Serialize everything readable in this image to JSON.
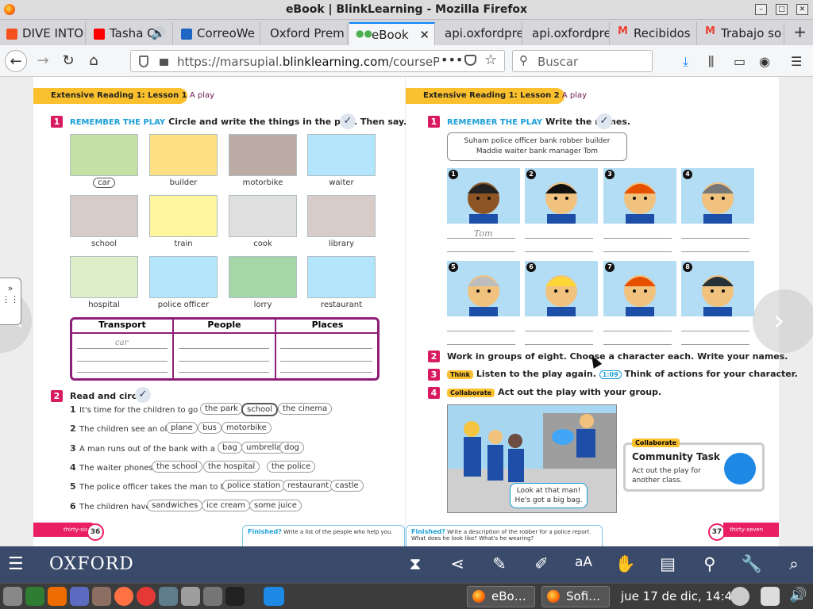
{
  "window": {
    "title": "eBook | BlinkLearning - Mozilla Firefox"
  },
  "tabs": [
    {
      "label": "DIVE INTO",
      "color": "#f4511e"
    },
    {
      "label": "Tasha C",
      "color": "#ff0000"
    },
    {
      "label": "CorreoWe",
      "color": "#1e66c4"
    },
    {
      "label": "Oxford Prem",
      "color": "#ffffff"
    },
    {
      "label": "eBook",
      "color": "#4caf50",
      "active": true
    },
    {
      "label": "api.oxfordpre",
      "color": "#ffffff"
    },
    {
      "label": "api.oxfordpre",
      "color": "#ffffff"
    },
    {
      "label": "Recibidos",
      "color": "#ea4335"
    },
    {
      "label": "Trabajo so",
      "color": "#ea4335"
    }
  ],
  "nav": {
    "url_prefix": "https://marsupial.",
    "url_domain": "blinklearning.com",
    "url_suffix": "/coursePlay",
    "search_placeholder": "Buscar"
  },
  "left": {
    "lesson_bold": "Extensive Reading 1: Lesson 1",
    "lesson_play": "A play",
    "ex1_num": "1",
    "ex1_tag": "REMEMBER THE PLAY",
    "ex1_text": "Circle and write the things in the play. Then say.",
    "pictures": [
      {
        "label": "car",
        "boxed": true,
        "color": "#c5e1a5"
      },
      {
        "label": "builder",
        "color": "#ffe082"
      },
      {
        "label": "motorbike",
        "color": "#bcaaa4"
      },
      {
        "label": "waiter",
        "color": "#b3e5fc"
      },
      {
        "label": "school",
        "color": "#d7ccc8"
      },
      {
        "label": "train",
        "color": "#fff59d"
      },
      {
        "label": "cook",
        "color": "#e0e0e0"
      },
      {
        "label": "library",
        "color": "#d7ccc8"
      },
      {
        "label": "hospital",
        "color": "#dcedc8"
      },
      {
        "label": "police officer",
        "color": "#b3e5fc"
      },
      {
        "label": "lorry",
        "color": "#a5d6a7"
      },
      {
        "label": "restaurant",
        "color": "#b3e5fc"
      }
    ],
    "table_headers": [
      "Transport",
      "People",
      "Places"
    ],
    "table_answer": "car",
    "ex2_num": "2",
    "ex2_text": "Read and circle.",
    "questions": [
      {
        "n": "1",
        "text": "It's time for the children to go to",
        "options": [
          "the park",
          "school",
          "the cinema"
        ],
        "selected": 1
      },
      {
        "n": "2",
        "text": "The children see an old",
        "options": [
          "plane",
          "bus",
          "motorbike"
        ],
        "selected": -1
      },
      {
        "n": "3",
        "text": "A man runs out of the bank with a big",
        "options": [
          "bag",
          "umbrella",
          "dog"
        ],
        "selected": -1
      },
      {
        "n": "4",
        "text": "The waiter phones",
        "options": [
          "the school",
          "the hospital",
          "the police"
        ],
        "selected": -1
      },
      {
        "n": "5",
        "text": "The police officer takes the man to the",
        "options": [
          "police station",
          "restaurant",
          "castle"
        ],
        "selected": -1
      },
      {
        "n": "6",
        "text": "The children have",
        "options": [
          "sandwiches",
          "ice cream",
          "some juice"
        ],
        "selected": -1
      }
    ],
    "page_word": "thirty-six",
    "page_no": "36",
    "finished_label": "Finished?",
    "finished_text": "Write a list of the people who help you."
  },
  "right": {
    "lesson_bold": "Extensive Reading 1: Lesson 2",
    "lesson_play": "A play",
    "ex1_num": "1",
    "ex1_tag": "REMEMBER THE PLAY",
    "ex1_text": "Write the names.",
    "names_line1": "Suham    police officer    bank robber    builder",
    "names_line2": "Maddie    waiter    bank manager    Tom",
    "faces": [
      "1",
      "2",
      "3",
      "4",
      "5",
      "6",
      "7",
      "8"
    ],
    "answer_1": "Tom",
    "ex2_num": "2",
    "ex2_text": "Work in groups of eight. Choose a character each. Write your names.",
    "ex3_num": "3",
    "ex3_tag": "Think",
    "ex3_text": "Listen to the play again.",
    "ex3_audio": "1:09",
    "ex3_text2": "Think of actions for your character.",
    "ex4_num": "4",
    "ex4_tag": "Collaborate",
    "ex4_text": "Act out the play with your group.",
    "bubble_1": "Look at that man!",
    "bubble_2": "He's got a big bag.",
    "task_label": "Collaborate",
    "task_title": "Community Task",
    "task_desc": "Act out the play for another class.",
    "page_word": "thirty-seven",
    "page_no": "37",
    "finished_label": "Finished?",
    "finished_text": "Write a description of the robber for a police report. What does he look like? What's he wearing?"
  },
  "appbar": {
    "logo": "OXFORD"
  },
  "taskbar": {
    "task1": "eBo…",
    "task2": "Sofi…",
    "clock": "jue 17 de dic, 14:43"
  }
}
